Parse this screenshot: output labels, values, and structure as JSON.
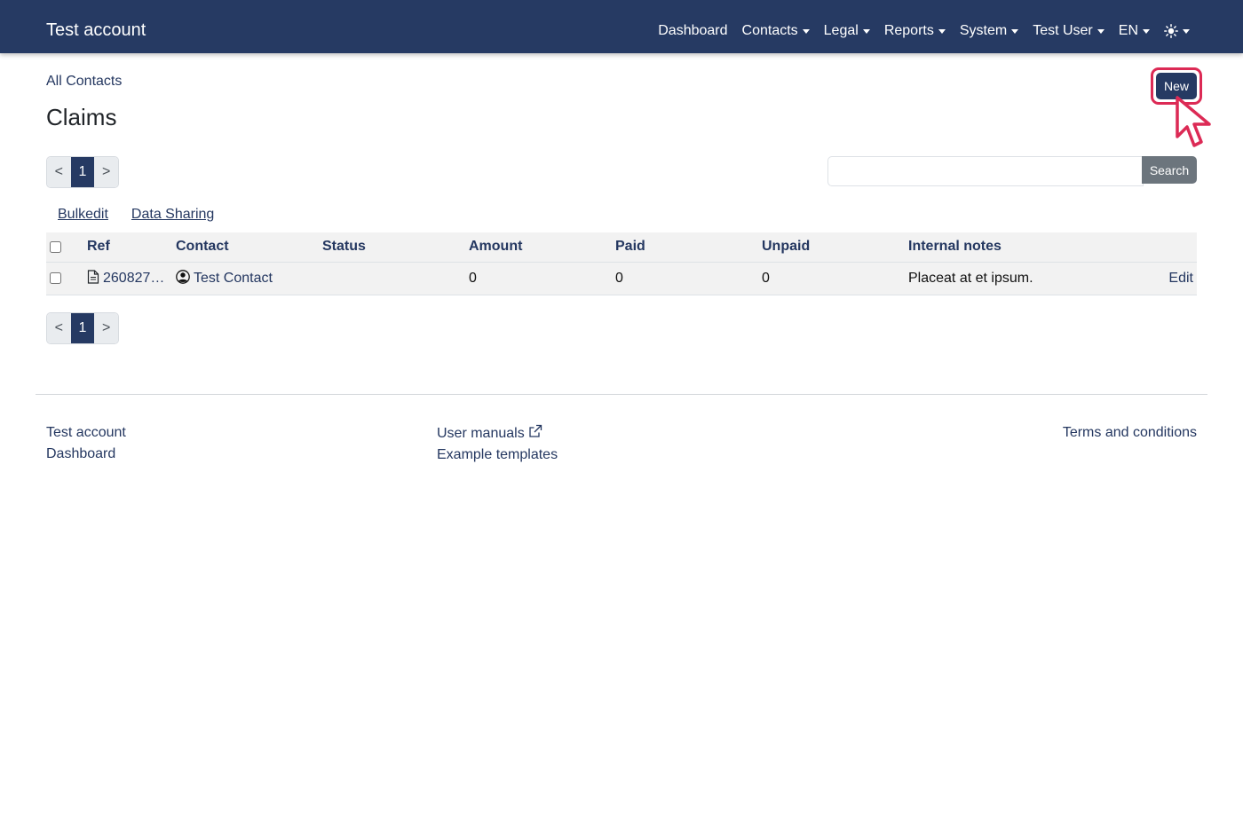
{
  "navbar": {
    "brand": "Test account",
    "items": [
      {
        "label": "Dashboard",
        "dropdown": false
      },
      {
        "label": "Contacts",
        "dropdown": true
      },
      {
        "label": "Legal",
        "dropdown": true
      },
      {
        "label": "Reports",
        "dropdown": true
      },
      {
        "label": "System",
        "dropdown": true
      },
      {
        "label": "Test User",
        "dropdown": true
      },
      {
        "label": "EN",
        "dropdown": true
      }
    ],
    "theme_icon": "sun-icon"
  },
  "breadcrumb": {
    "label": "All Contacts"
  },
  "page": {
    "title": "Claims",
    "new_button": "New"
  },
  "pagination": {
    "prev": "<",
    "current": "1",
    "next": ">"
  },
  "search": {
    "value": "",
    "button": "Search"
  },
  "actions": {
    "bulkedit": "Bulkedit",
    "data_sharing": "Data Sharing"
  },
  "table": {
    "headers": {
      "ref": "Ref",
      "contact": "Contact",
      "status": "Status",
      "amount": "Amount",
      "paid": "Paid",
      "unpaid": "Unpaid",
      "notes": "Internal notes"
    },
    "rows": [
      {
        "ref": "260827…",
        "contact": "Test Contact",
        "status": "",
        "amount": "0",
        "paid": "0",
        "unpaid": "0",
        "notes": "Placeat at et ipsum.",
        "edit": "Edit"
      }
    ]
  },
  "footer": {
    "col1": [
      "Test account",
      "Dashboard"
    ],
    "col2": [
      "User manuals",
      "Example templates"
    ],
    "col3": [
      "Terms and conditions"
    ]
  },
  "colors": {
    "navbar": "#263a63",
    "highlight": "#dc2a55",
    "search_button": "#6c757d"
  }
}
